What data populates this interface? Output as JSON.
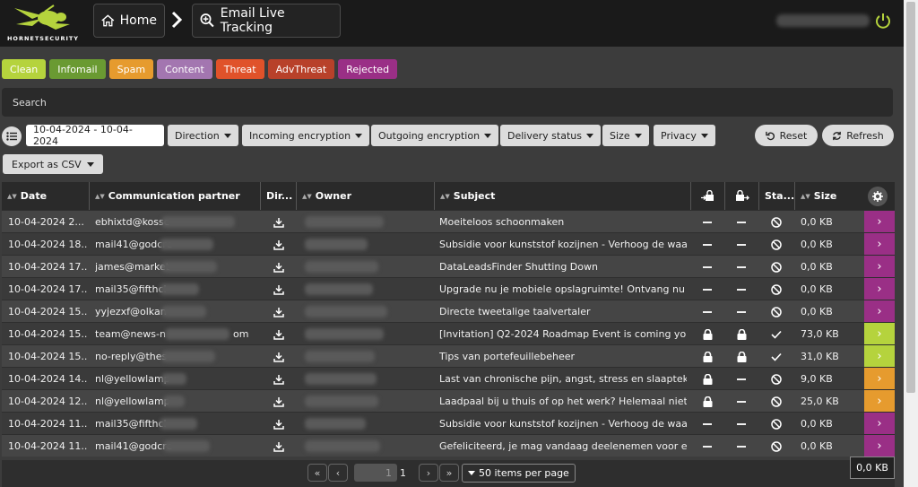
{
  "header": {
    "logo_text": "HORNETSECURITY",
    "breadcrumb_home": "Home",
    "breadcrumb_current": "Email Live Tracking"
  },
  "filters": [
    {
      "label": "Clean",
      "color": "#b5d33d"
    },
    {
      "label": "Infomail",
      "color": "#6a9a32"
    },
    {
      "label": "Spam",
      "color": "#e69b2e"
    },
    {
      "label": "Content",
      "color": "#a376b0"
    },
    {
      "label": "Threat",
      "color": "#e0522a"
    },
    {
      "label": "AdvThreat",
      "color": "#b8412a"
    },
    {
      "label": "Rejected",
      "color": "#9a2f86"
    }
  ],
  "search": {
    "placeholder": "Search"
  },
  "toolbar": {
    "date_range": "10-04-2024 - 10-04-2024",
    "direction": "Direction",
    "incoming_encryption": "Incoming encryption",
    "outgoing_encryption": "Outgoing encryption",
    "delivery_status": "Delivery status",
    "size": "Size",
    "privacy": "Privacy",
    "reset": "Reset",
    "refresh": "Refresh",
    "export": "Export as CSV"
  },
  "table": {
    "columns": {
      "date": "Date",
      "partner": "Communication partner",
      "direction": "Dir...",
      "owner": "Owner",
      "subject": "Subject",
      "status": "Sta...",
      "size": "Size"
    },
    "rows": [
      {
        "date": "10-04-2024 2...",
        "partner": "ebhixtd@kosse",
        "subject": "Moeiteloos schoonmaken",
        "in_enc": "dash",
        "out_enc": "dash",
        "status": "blocked",
        "size": "0,0 KB",
        "color": "#9a2f86"
      },
      {
        "date": "10-04-2024 18...",
        "partner": "mail41@godcre",
        "subject": "Subsidie voor kunststof kozijnen - Verhoog de waar...",
        "in_enc": "dash",
        "out_enc": "dash",
        "status": "blocked",
        "size": "0,0 KB",
        "color": "#9a2f86"
      },
      {
        "date": "10-04-2024 17...",
        "partner": "james@market",
        "subject": "DataLeadsFinder Shutting Down",
        "in_enc": "dash",
        "out_enc": "dash",
        "status": "blocked",
        "size": "0,0 KB",
        "color": "#9a2f86"
      },
      {
        "date": "10-04-2024 17...",
        "partner": "mail35@fifthcl",
        "subject": "Upgrade nu je mobiele opslagruimte! Ontvang nu 5...",
        "in_enc": "dash",
        "out_enc": "dash",
        "status": "blocked",
        "size": "0,0 KB",
        "color": "#9a2f86"
      },
      {
        "date": "10-04-2024 15...",
        "partner": "yyjezxf@olkan",
        "subject": "Directe tweetalige taalvertaler",
        "in_enc": "dash",
        "out_enc": "dash",
        "status": "blocked",
        "size": "0,0 KB",
        "color": "#9a2f86"
      },
      {
        "date": "10-04-2024 15...",
        "partner": "team@news-n",
        "partner_suffix": "om",
        "subject": "[Invitation] Q2-2024 Roadmap Event is coming you...",
        "in_enc": "lock",
        "out_enc": "lock",
        "status": "check",
        "size": "73,0 KB",
        "color": "#b5d33d"
      },
      {
        "date": "10-04-2024 15...",
        "partner": "no-reply@thes",
        "subject": "Tips van portefeuillebeheer",
        "in_enc": "lock",
        "out_enc": "lock",
        "status": "check",
        "size": "31,0 KB",
        "color": "#b5d33d"
      },
      {
        "date": "10-04-2024 14...",
        "partner": "nl@yellowlamp",
        "subject": "Last van chronische pijn, angst, stress en slaapteko...",
        "in_enc": "lock",
        "out_enc": "dash",
        "status": "blocked",
        "size": "9,0 KB",
        "color": "#e69b2e"
      },
      {
        "date": "10-04-2024 12...",
        "partner": "nl@yellowlamp",
        "subject": "Laadpaal bij u thuis of op het werk? Helemaal niet ...",
        "in_enc": "lock",
        "out_enc": "dash",
        "status": "blocked",
        "size": "25,0 KB",
        "color": "#e69b2e"
      },
      {
        "date": "10-04-2024 11...",
        "partner": "mail35@fifthcl",
        "subject": "Subsidie voor kunststof kozijnen - Verhoog de waar...",
        "in_enc": "dash",
        "out_enc": "dash",
        "status": "blocked",
        "size": "0,0 KB",
        "color": "#9a2f86"
      },
      {
        "date": "10-04-2024 11...",
        "partner": "mail41@godcre",
        "subject": "Gefeliciteerd, je mag vandaag deelenemen voor ee...",
        "in_enc": "dash",
        "out_enc": "dash",
        "status": "blocked",
        "size": "0,0 KB",
        "color": "#9a2f86"
      }
    ]
  },
  "pager": {
    "current_page": "1",
    "total_pages": "1",
    "per_page": "50 items per page"
  },
  "tooltip": "0,0 KB"
}
